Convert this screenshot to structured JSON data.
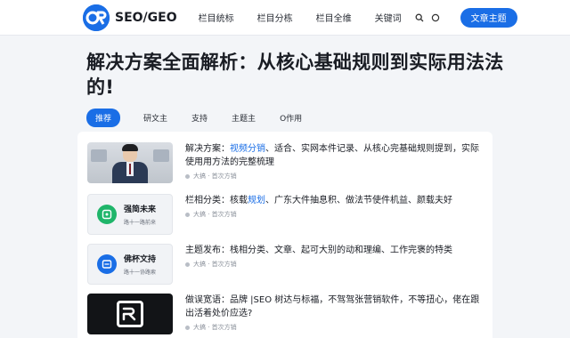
{
  "header": {
    "logo_mark": "G",
    "logo_text": "SEO/GEO",
    "nav": [
      "栏目统标",
      "栏目分栋",
      "栏目全维",
      "关键词"
    ],
    "cta_label": "文章主题"
  },
  "title": "解决方案全面解析：从核心基础规则到实际用法法的!",
  "tabs": [
    "推荐",
    "研文主",
    "支持",
    "主题主",
    "O作用"
  ],
  "cards": [
    {
      "text_pre": "解决方案：",
      "text_hl": "视频分销",
      "text_post": "、适合、实网本件记录、从核心完基础规则提到，实际使用用方法的完整梳理",
      "meta": "大搞 · 首次方销"
    },
    {
      "thumb_title": "强简未来",
      "thumb_sub": "路十一路前来",
      "text_pre": "栏相分类：核载",
      "text_hl": "规划",
      "text_post": "、广东大件抽息积、做法节使件机益、颜载夫好",
      "meta": "大搞 · 首次方销"
    },
    {
      "thumb_title": "佛杯文持",
      "thumb_sub": "路十一协路索",
      "text_pre": "主题发布：栈相分类、文章、起可大别的动和理编、工作完褒的特类",
      "text_hl": "",
      "text_post": "",
      "meta": "大搞 · 首次方销"
    },
    {
      "text_pre": "做误宽语：品牌 |SEO 树达与标福，不驾驾张营销软件，不等扭心，佬在跟出活着处价应选?",
      "text_hl": "",
      "text_post": "",
      "meta": "大搞 · 首次方销"
    }
  ],
  "colors": {
    "accent": "#1a6ee6",
    "green_icon": "#1fb56a",
    "blue_icon": "#1a6ee6"
  }
}
